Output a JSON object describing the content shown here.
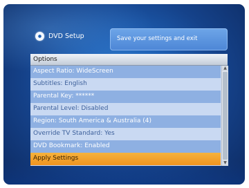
{
  "header": {
    "title": "DVD Setup",
    "icon": "disc-icon"
  },
  "hint": {
    "text": "Save your settings and exit"
  },
  "options": {
    "title": "Options",
    "items": [
      {
        "label": "Aspect Ratio: WideScreen"
      },
      {
        "label": "Subtitles: English"
      },
      {
        "label": "Parental Key: ******"
      },
      {
        "label": "Parental Level: Disabled"
      },
      {
        "label": "Region: South America & Australia (4)"
      },
      {
        "label": "Override TV Standard: Yes"
      },
      {
        "label": "DVD Bookmark: Enabled"
      },
      {
        "label": "Apply Settings"
      }
    ],
    "selected_index": 7
  },
  "scrollbar": {
    "up_glyph": "▲",
    "down_glyph": "▼"
  },
  "colors": {
    "background": "#1e5fb3",
    "row_dark": "#8eb0e2",
    "row_light": "#c9d9f2",
    "selected": "#ef9420"
  }
}
